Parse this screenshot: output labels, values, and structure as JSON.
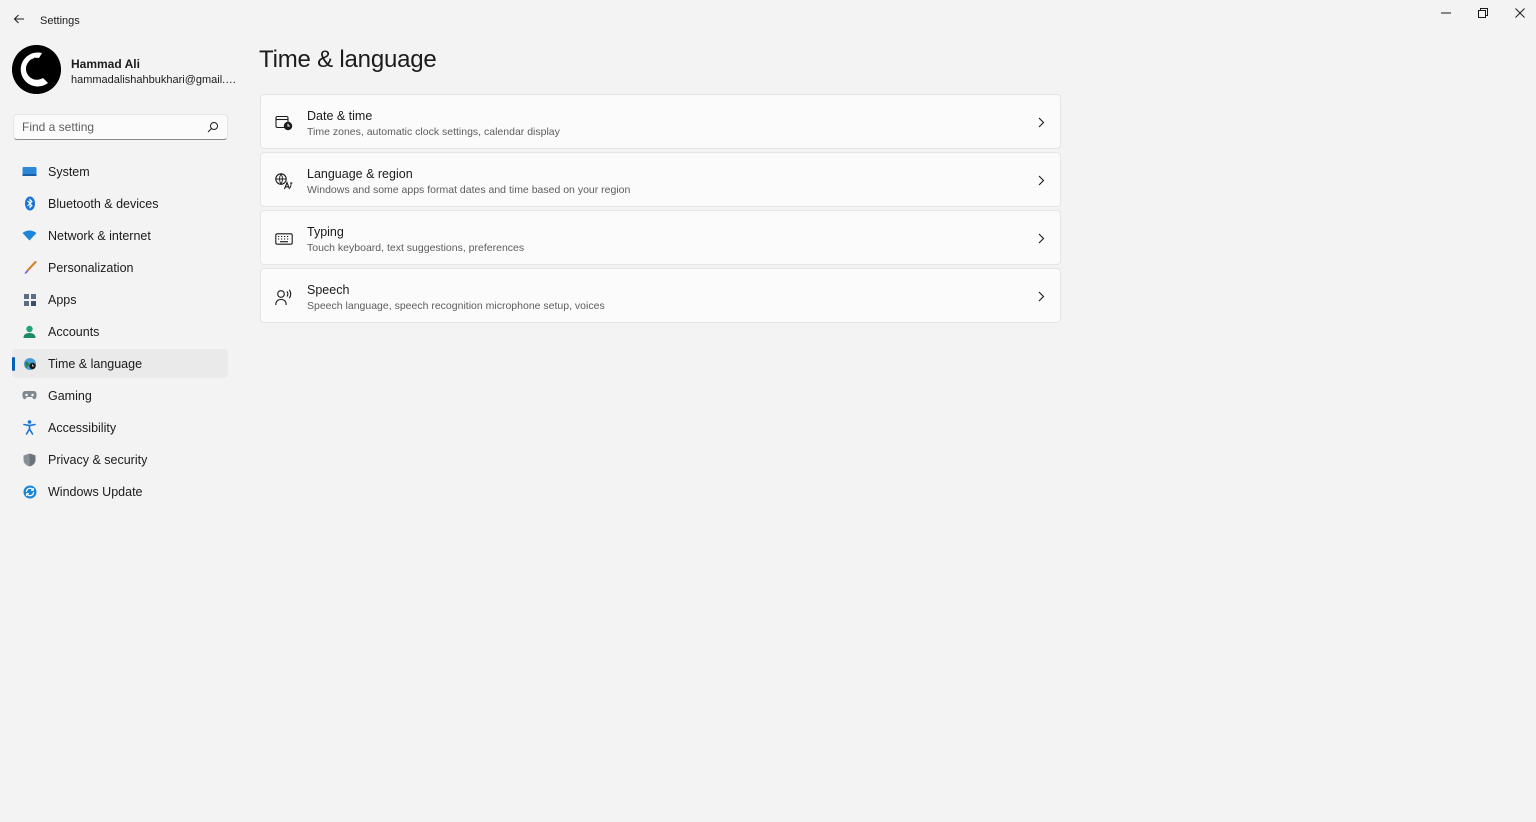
{
  "window": {
    "title": "Settings",
    "controls": {
      "minimize_icon": "minimize-icon",
      "maximize_icon": "restore-icon",
      "close_icon": "close-icon"
    }
  },
  "profile": {
    "name": "Hammad Ali",
    "email": "hammadalishahbukhari@gmail.com"
  },
  "search": {
    "placeholder": "Find a setting",
    "value": ""
  },
  "sidebar": {
    "items": [
      {
        "label": "System",
        "icon": "system-icon",
        "active": false
      },
      {
        "label": "Bluetooth & devices",
        "icon": "bluetooth-icon",
        "active": false
      },
      {
        "label": "Network & internet",
        "icon": "wifi-icon",
        "active": false
      },
      {
        "label": "Personalization",
        "icon": "brush-icon",
        "active": false
      },
      {
        "label": "Apps",
        "icon": "apps-icon",
        "active": false
      },
      {
        "label": "Accounts",
        "icon": "accounts-icon",
        "active": false
      },
      {
        "label": "Time & language",
        "icon": "globe-clock-icon",
        "active": true
      },
      {
        "label": "Gaming",
        "icon": "gamepad-icon",
        "active": false
      },
      {
        "label": "Accessibility",
        "icon": "accessibility-icon",
        "active": false
      },
      {
        "label": "Privacy & security",
        "icon": "shield-icon",
        "active": false
      },
      {
        "label": "Windows Update",
        "icon": "update-icon",
        "active": false
      }
    ]
  },
  "main": {
    "title": "Time & language",
    "cards": [
      {
        "title": "Date & time",
        "description": "Time zones, automatic clock settings, calendar display",
        "icon": "calendar-clock-icon"
      },
      {
        "title": "Language & region",
        "description": "Windows and some apps format dates and time based on your region",
        "icon": "language-icon"
      },
      {
        "title": "Typing",
        "description": "Touch keyboard, text suggestions, preferences",
        "icon": "keyboard-icon"
      },
      {
        "title": "Speech",
        "description": "Speech language, speech recognition microphone setup, voices",
        "icon": "speech-icon"
      }
    ]
  },
  "colors": {
    "background": "#f3f3f3",
    "card": "#fbfbfb",
    "accent": "#005fb8",
    "active_item": "#eaeaea"
  }
}
